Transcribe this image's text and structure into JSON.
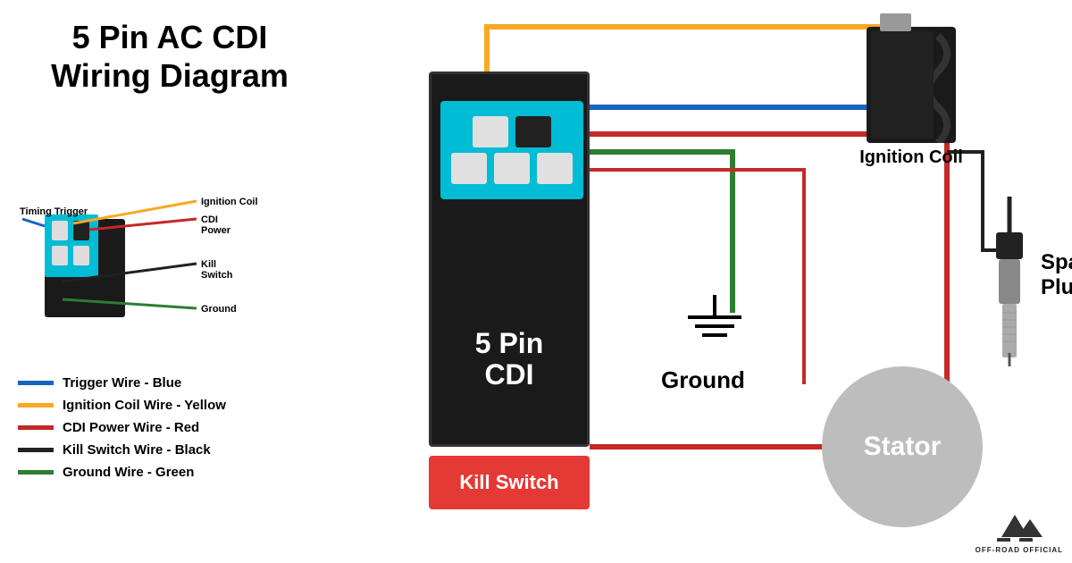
{
  "title": {
    "line1": "5 Pin AC CDI",
    "line2": "Wiring Diagram"
  },
  "legend": {
    "items": [
      {
        "color": "#1565c0",
        "label": "Trigger Wire - Blue"
      },
      {
        "color": "#f9a825",
        "label": "Ignition Coil Wire - Yellow"
      },
      {
        "color": "#c62828",
        "label": "CDI Power Wire - Red"
      },
      {
        "color": "#212121",
        "label": "Kill Switch Wire - Black"
      },
      {
        "color": "#2e7d32",
        "label": "Ground Wire - Green"
      }
    ]
  },
  "labels": {
    "cdi_main": "5 Pin\nCDI",
    "kill_switch": "Kill Switch",
    "ground": "Ground",
    "ignition_coil": "Ignition\nCoil",
    "spark_plug": "Spark\nPlug",
    "stator": "Stator",
    "timing_trigger": "Timing Trigger",
    "ignition_coil_small": "Ignition Coil",
    "cdi_power_small": "CDI\nPower",
    "kill_switch_small": "Kill\nSwitch",
    "ground_small": "Ground",
    "off_road": "OFF-ROAD OFFICIAL"
  },
  "colors": {
    "blue": "#1565c0",
    "yellow": "#f9a825",
    "red": "#c62828",
    "black": "#212121",
    "green": "#2e7d32",
    "cdi_bg": "#1a1a1a",
    "connector_bg": "#00bcd4",
    "kill_switch_bg": "#e53935",
    "stator_bg": "#bdbdbd"
  }
}
